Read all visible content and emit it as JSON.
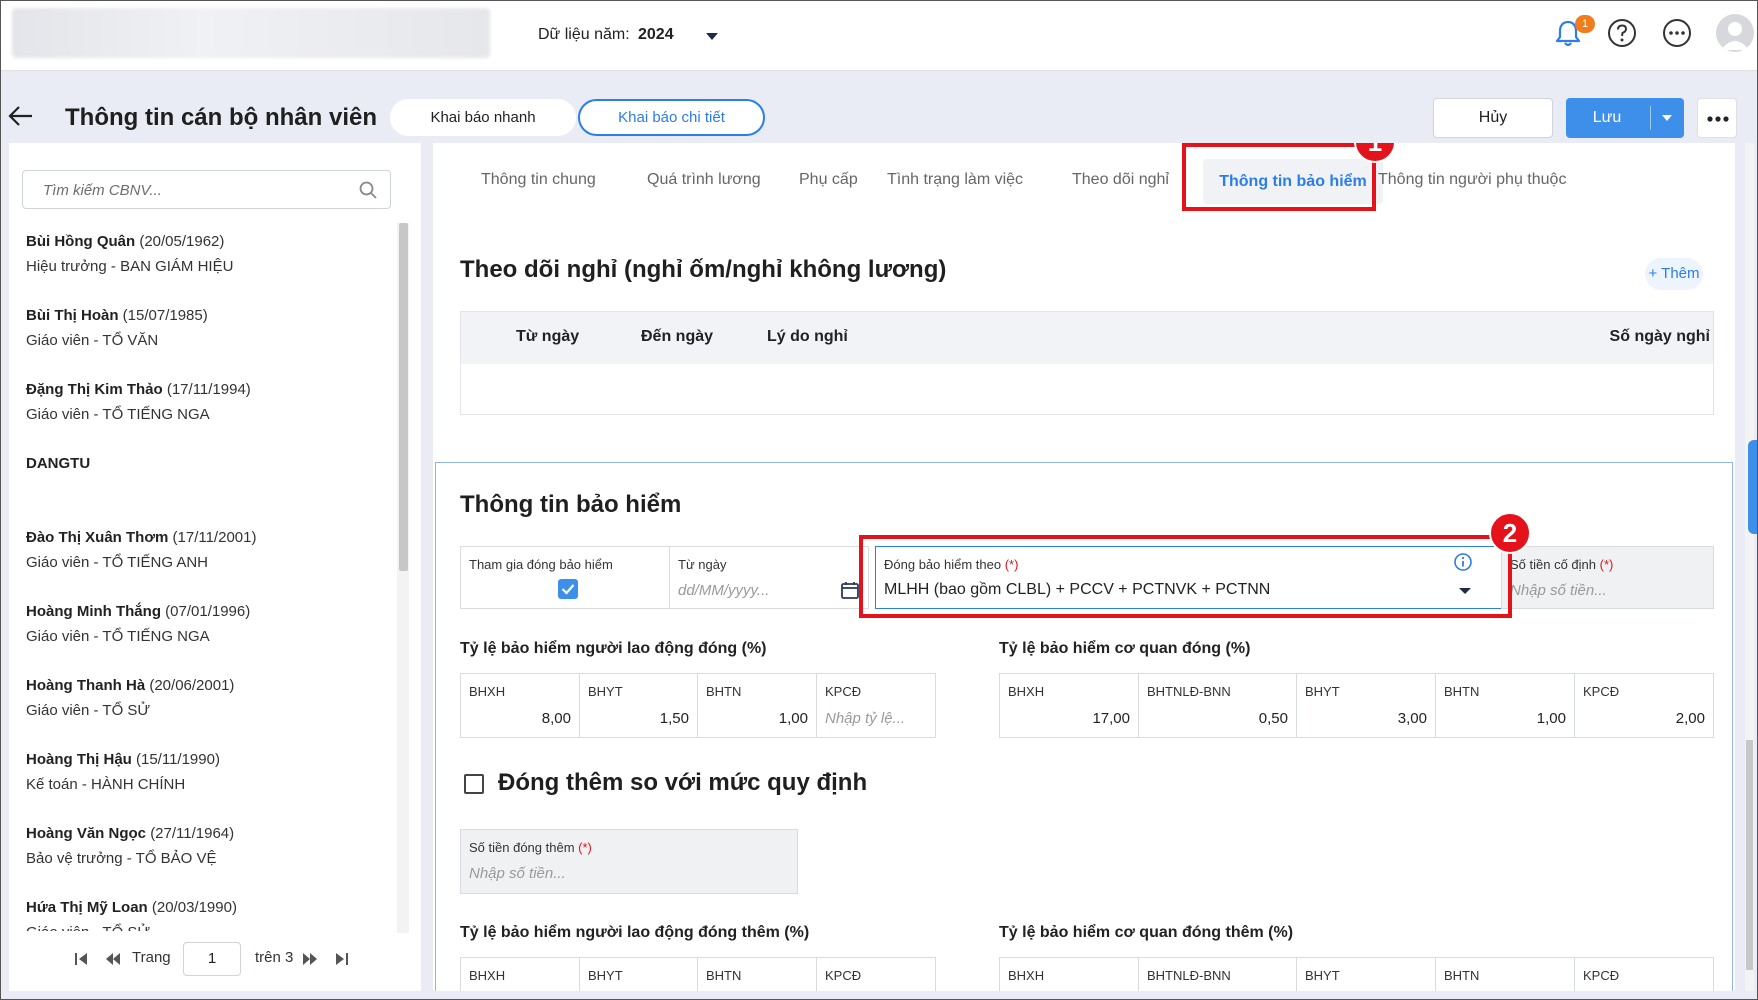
{
  "header": {
    "year_label": "Dữ liệu năm:",
    "year_value": "2024",
    "notification_count": "1"
  },
  "page": {
    "title": "Thông tin cán bộ nhân viên",
    "mode_quick": "Khai báo nhanh",
    "mode_detail": "Khai báo chi tiết",
    "cancel_label": "Hủy",
    "save_label": "Lưu"
  },
  "sidebar": {
    "search_placeholder": "Tìm kiếm CBNV...",
    "employees": [
      {
        "name": "Bùi Hồng Quân",
        "dob": "(20/05/1962)",
        "role": "Hiệu trưởng - BAN GIÁM HIỆU"
      },
      {
        "name": "Bùi Thị Hoàn",
        "dob": "(15/07/1985)",
        "role": "Giáo viên - TỔ VĂN"
      },
      {
        "name": "Đặng Thị Kim Thảo",
        "dob": "(17/11/1994)",
        "role": "Giáo viên - TỔ TIẾNG NGA"
      },
      {
        "name": "DANGTU",
        "dob": "",
        "role": ""
      },
      {
        "name": "Đào Thị Xuân Thơm",
        "dob": "(17/11/2001)",
        "role": "Giáo viên - TỔ TIẾNG ANH"
      },
      {
        "name": "Hoàng Minh Thắng",
        "dob": "(07/01/1996)",
        "role": "Giáo viên - TỔ TIẾNG NGA"
      },
      {
        "name": "Hoàng Thanh Hà",
        "dob": "(20/06/2001)",
        "role": "Giáo viên - TỔ SỬ"
      },
      {
        "name": "Hoàng Thị Hậu",
        "dob": "(15/11/1990)",
        "role": "Kế toán - HÀNH CHÍNH"
      },
      {
        "name": "Hoàng Văn Ngọc",
        "dob": "(27/11/1964)",
        "role": "Bảo vệ trưởng - TỔ BẢO VỆ"
      },
      {
        "name": "Hứa Thị Mỹ Loan",
        "dob": "(20/03/1990)",
        "role": "Giáo viên - TỔ SỬ"
      }
    ],
    "pager": {
      "label": "Trang",
      "page": "1",
      "total": "trên 3"
    }
  },
  "tabs": [
    "Thông tin chung",
    "Quá trình lương",
    "Phụ cấp",
    "Tình trạng làm việc",
    "Theo dõi nghỉ",
    "Thông tin bảo hiểm",
    "Thông tin người phụ thuộc"
  ],
  "annotations": {
    "step1": "1",
    "step2": "2"
  },
  "leave": {
    "title": "Theo dõi nghỉ (nghỉ ốm/nghỉ không lương)",
    "add_label": "+ Thêm",
    "columns": [
      "Từ ngày",
      "Đến ngày",
      "Lý do nghỉ",
      "Số ngày nghỉ"
    ]
  },
  "insurance": {
    "title": "Thông tin bảo hiểm",
    "participate_label": "Tham gia đóng bảo hiểm",
    "from_date_label": "Từ ngày",
    "from_date_placeholder": "dd/MM/yyyy...",
    "basis_label": "Đóng bảo hiểm theo",
    "basis_value": "MLHH (bao gồm CLBL) + PCCV + PCTNVK + PCTNN",
    "fixed_amount_label": "Số tiền cố định",
    "fixed_amount_placeholder": "Nhập số tiền...",
    "required_mark": "(*)",
    "employee_rate_title": "Tỷ lệ bảo hiểm người lao động đóng (%)",
    "employee_rates": [
      {
        "label": "BHXH",
        "value": "8,00"
      },
      {
        "label": "BHYT",
        "value": "1,50"
      },
      {
        "label": "BHTN",
        "value": "1,00"
      },
      {
        "label": "KPCĐ",
        "value": "",
        "placeholder": "Nhập tỷ lệ..."
      }
    ],
    "agency_rate_title": "Tỷ lệ bảo hiểm cơ quan đóng (%)",
    "agency_rates": [
      {
        "label": "BHXH",
        "value": "17,00"
      },
      {
        "label": "BHTNLĐ-BNN",
        "value": "0,50"
      },
      {
        "label": "BHYT",
        "value": "3,00"
      },
      {
        "label": "BHTN",
        "value": "1,00"
      },
      {
        "label": "KPCĐ",
        "value": "2,00"
      }
    ],
    "extra_title": "Đóng thêm so với mức quy định",
    "extra_amount_label": "Số tiền đóng thêm",
    "extra_amount_placeholder": "Nhập số tiền...",
    "employee_extra_title": "Tỷ lệ bảo hiểm người lao động đóng thêm (%)",
    "employee_extra_cols": [
      "BHXH",
      "BHYT",
      "BHTN",
      "KPCĐ"
    ],
    "agency_extra_title": "Tỷ lệ bảo hiểm cơ quan đóng thêm (%)",
    "agency_extra_cols": [
      "BHXH",
      "BHTNLĐ-BNN",
      "BHYT",
      "BHTN",
      "KPCĐ"
    ]
  },
  "colors": {
    "accent": "#2b7de9",
    "highlight": "#e4121b",
    "badge": "#f07c1e"
  }
}
